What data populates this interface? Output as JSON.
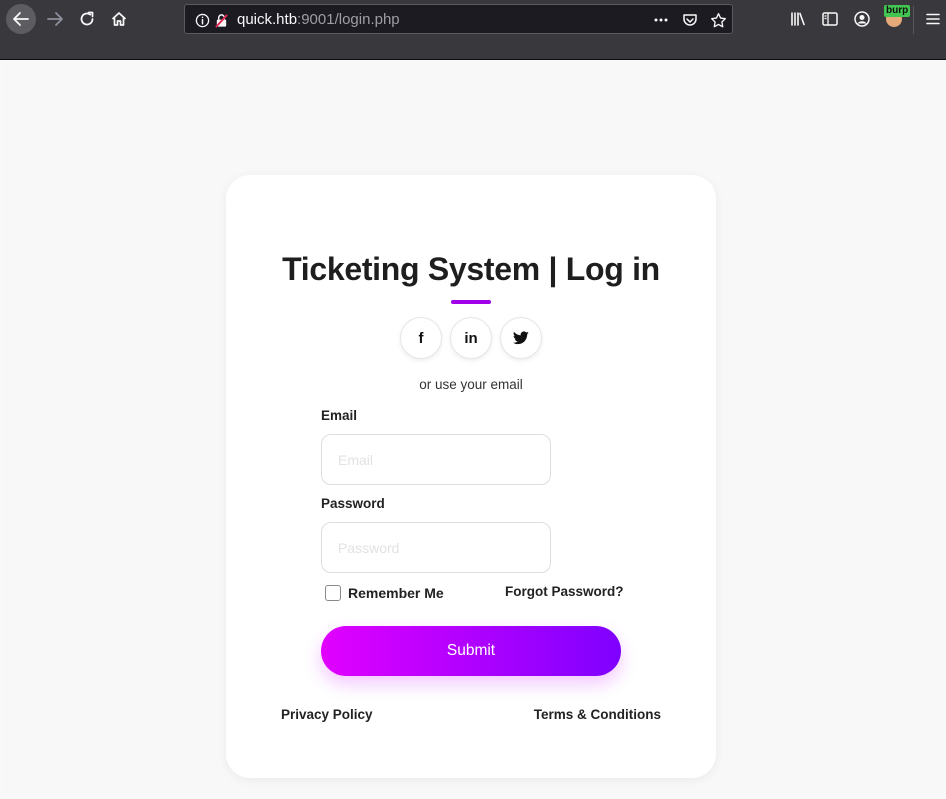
{
  "browser": {
    "url_host": "quick.htb",
    "url_rest": ":9001/login.php",
    "extension_badge": "burp",
    "icons": [
      "back-arrow-icon",
      "forward-arrow-icon",
      "reload-icon",
      "home-icon",
      "info-icon",
      "insecure-lock-icon",
      "page-actions-icon",
      "pocket-icon",
      "bookmark-star-icon",
      "library-icon",
      "sidebar-icon",
      "account-icon",
      "extension-avatar-icon",
      "menu-icon"
    ]
  },
  "login": {
    "title": "Ticketing System | Log in",
    "social": {
      "facebook": "f",
      "linkedin": "in",
      "twitter_icon": "twitter-bird-icon"
    },
    "or_text": "or use your email",
    "email_label": "Email",
    "email_placeholder": "Email",
    "email_value": "",
    "password_label": "Password",
    "password_placeholder": "Password",
    "password_value": "",
    "remember_label": "Remember Me",
    "remember_checked": false,
    "forgot_label": "Forgot Password?",
    "submit_label": "Submit",
    "privacy_label": "Privacy Policy",
    "terms_label": "Terms & Conditions"
  },
  "colors": {
    "accent": "#a000e8",
    "button_start": "#e100ff",
    "button_end": "#7f00ff",
    "toolbar": "#38383d",
    "urlbar": "#1c1b22"
  }
}
